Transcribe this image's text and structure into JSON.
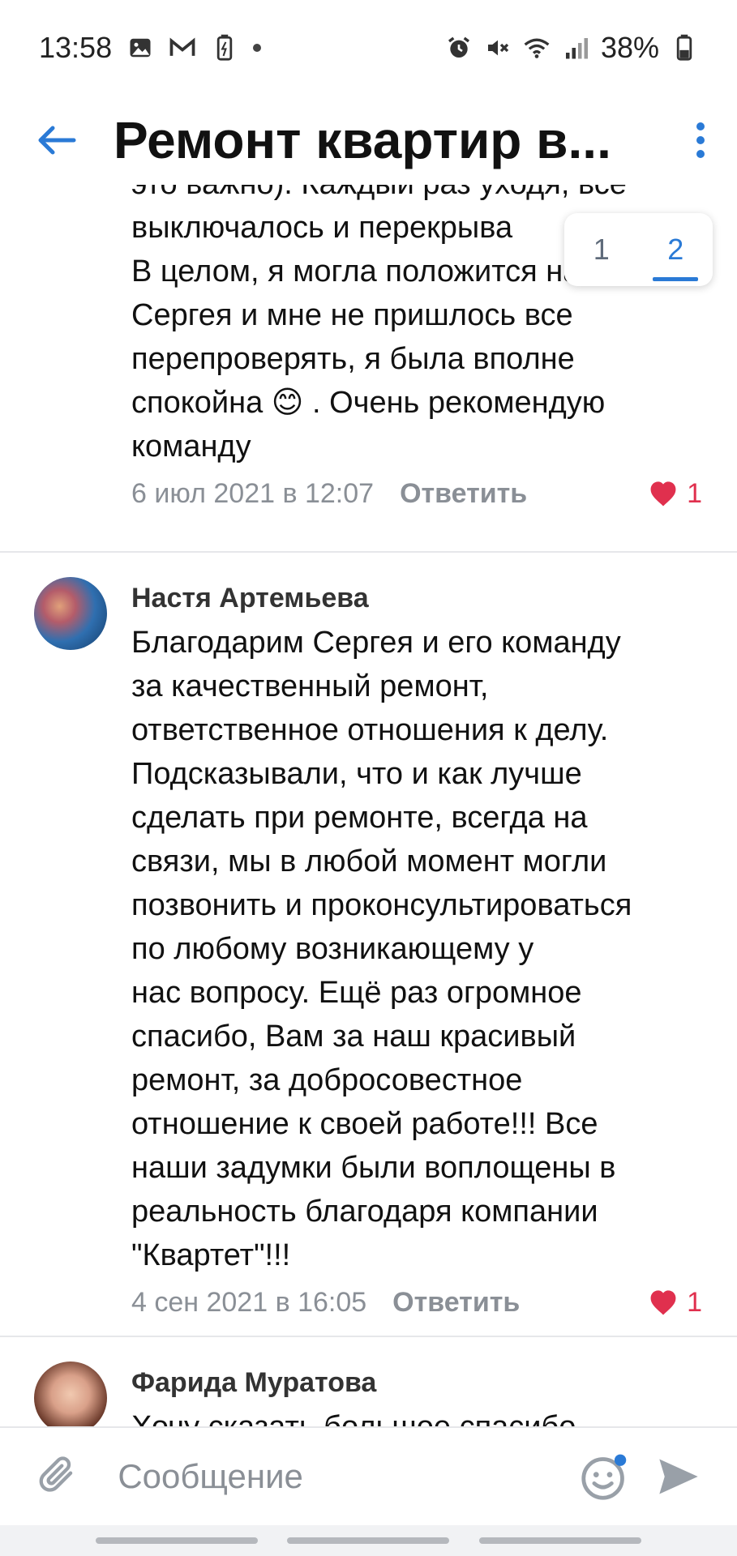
{
  "status_bar": {
    "time": "13:58",
    "battery": "38%",
    "icons": [
      "image-icon",
      "gmail-icon",
      "battery-saver-icon",
      "alarm-icon",
      "mute-icon",
      "wifi-icon",
      "signal-icon",
      "battery-icon"
    ]
  },
  "header": {
    "title": "Ремонт квартир в..."
  },
  "pager": {
    "pages": [
      "1",
      "2"
    ],
    "active": "2"
  },
  "comments": [
    {
      "text_lines": [
        "это важно). Каждый раз уходя, все",
        "выключалось и перекрыва",
        "В целом, я могла положится на",
        "Сергея и мне не пришлось все",
        "перепроверять, я была вполне",
        "спокойна 😊 . Очень рекомендую",
        "команду"
      ],
      "date": "6 июл 2021 в 12:07",
      "reply": "Ответить",
      "likes": "1"
    },
    {
      "author": "Настя Артемьева",
      "text_lines": [
        "Благодарим Сергея и его команду",
        "за качественный ремонт,",
        "ответственное отношения к делу.",
        "Подсказывали, что и как лучше",
        "сделать при ремонте, всегда на",
        "связи, мы в любой момент могли",
        "позвонить и проконсультироваться",
        "по любому возникающему у",
        "нас вопросу. Ещё раз огромное",
        "спасибо, Вам за наш красивый",
        "ремонт, за добросовестное",
        "отношение к своей работе!!! Все",
        "наши задумки были воплощены в",
        "реальность благодаря компании",
        "\"Квартет\"!!!"
      ],
      "date": "4 сен 2021 в 16:05",
      "reply": "Ответить",
      "likes": "1"
    },
    {
      "author": "Фарида Муратова",
      "text_lines": [
        "Хочу сказать большое спасибо"
      ]
    }
  ],
  "input": {
    "placeholder": "Сообщение"
  },
  "colors": {
    "accent": "#2a7ad6",
    "like": "#e0304e",
    "meta": "#8a8f96"
  }
}
